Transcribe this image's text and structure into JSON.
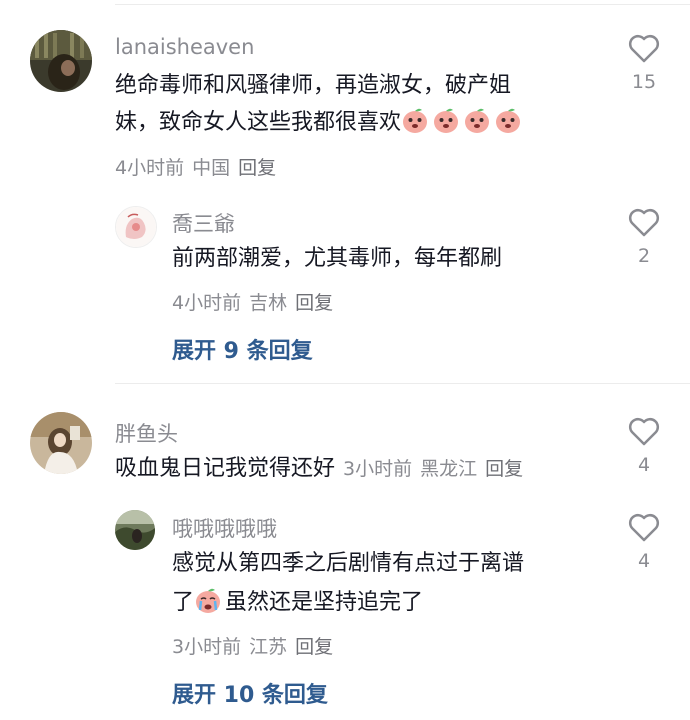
{
  "comments": [
    {
      "username": "lanaisheaven",
      "text_line1": "绝命毒师和风骚律师，再造淑女，破产姐",
      "text_line2": "妹，致命女人这些我都很喜欢",
      "time": "4小时前",
      "location": "中国",
      "reply_label": "回复",
      "likes": "15"
    },
    {
      "username": "喬三爺",
      "text_line1": "前两部潮爱，尤其毒师，每年都刷",
      "time": "4小时前",
      "location": "吉林",
      "reply_label": "回复",
      "likes": "2"
    },
    {
      "expand_label": "展开 9 条回复"
    },
    {
      "username": "胖鱼头",
      "text_line1": "吸血鬼日记我觉得还好",
      "time": "3小时前",
      "location": "黑龙江",
      "reply_label": "回复",
      "likes": "4"
    },
    {
      "username": "哦哦哦哦哦",
      "text_line1": "感觉从第四季之后剧情有点过于离谱",
      "text_line2_prefix": "了",
      "text_line2_suffix": "虽然还是坚持追完了",
      "time": "3小时前",
      "location": "江苏",
      "reply_label": "回复",
      "likes": "4"
    },
    {
      "expand_label": "展开 10 条回复"
    }
  ],
  "icons": {
    "like": "heart-outline-icon",
    "emoji_peach": "peach-cry-emoji",
    "emoji_cry": "crying-face-emoji"
  },
  "colors": {
    "username": "#8a8b91",
    "text": "#161823",
    "expand": "#2f5b8f"
  }
}
